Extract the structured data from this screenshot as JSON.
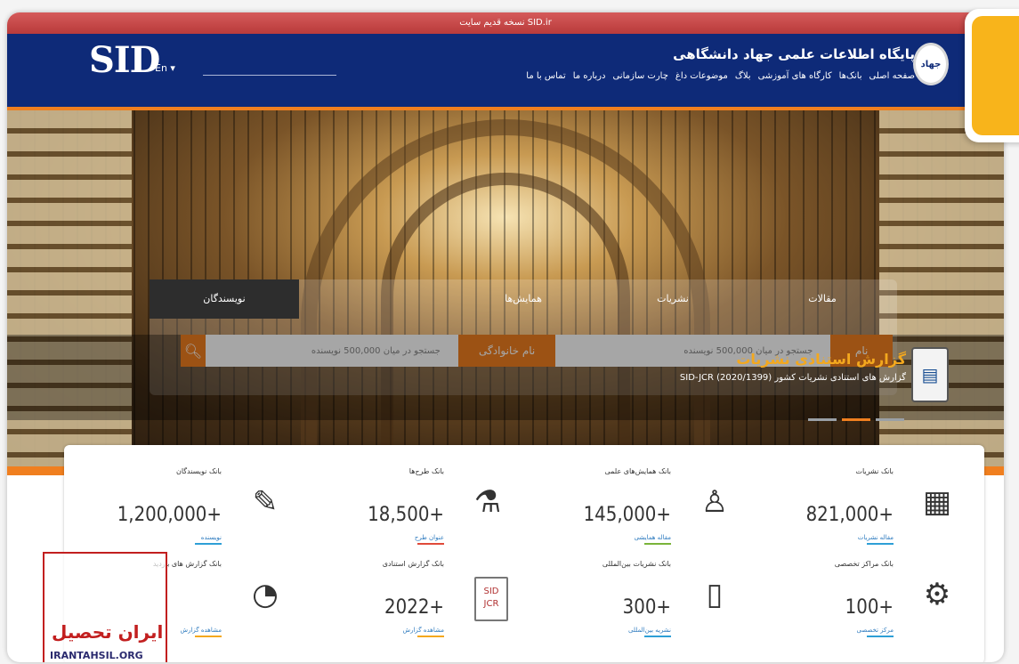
{
  "header": {
    "old_site_link": "نسخه قدیم سایت SID.ir",
    "logo": "SID",
    "language": "En",
    "site_title": "پایگاه اطلاعات علمی جهاد دانشگاهی",
    "nav_items": [
      "صفحه اصلی",
      "بانک‌ها",
      "کارگاه های آموزشی",
      "بلاگ",
      "موضوعات داغ",
      "چارت سازمانی",
      "درباره ما",
      "تماس با ما"
    ],
    "emblem_text": "جهاد"
  },
  "search": {
    "tabs": [
      "مقالات",
      "نشریات",
      "همایش‌ها",
      "",
      "نویسندگان"
    ],
    "active_tab_index": 4,
    "field1_label": "نام",
    "field1_placeholder": "جستجو در میان 500,000 نویسنده",
    "field2_label": "نام خانوادگی",
    "field2_placeholder": "جستجو در میان 500,000 نویسنده",
    "search_icon": "search-icon"
  },
  "report": {
    "title": "گزارش استنادی نشریات",
    "subtitle": "گزارش های استنادی نشریات کشور SID-JCR (2020/1399)"
  },
  "stats": [
    {
      "label": "بانک نشریات",
      "value": "821,000+",
      "link": "مقاله نشریات",
      "icon": "journal-icon",
      "accent": "#2e9fd6"
    },
    {
      "label": "بانک همایش‌های علمی",
      "value": "145,000+",
      "link": "مقاله همایشی",
      "icon": "lectern-icon",
      "accent": "#7ab43a"
    },
    {
      "label": "بانک طرح‌ها",
      "value": "18,500+",
      "link": "عنوان طرح",
      "icon": "microscope-icon",
      "accent": "#e04a3a"
    },
    {
      "label": "بانک نویسندگان",
      "value": "1,200,000+",
      "link": "نویسنده",
      "icon": "pen-icon",
      "accent": "#2e9fd6"
    },
    {
      "label": "بانک مراکز تخصصی",
      "value": "100+",
      "link": "مرکز تخصصی",
      "icon": "gear-hex-icon",
      "accent": "#2e9fd6"
    },
    {
      "label": "بانک نشریات بین‌المللی",
      "value": "300+",
      "link": "نشریه بین‌المللی",
      "icon": "mobile-doc-icon",
      "accent": "#2e9fd6"
    },
    {
      "label": "بانک گزارش استنادی",
      "value": "2022+",
      "link": "مشاهده گزارش",
      "icon": "sid-jcr-icon",
      "accent": "#f3a81e"
    },
    {
      "label": "بانک گزارش های بازدید",
      "value": "",
      "link": "مشاهده گزارش",
      "icon": "report-chart-icon",
      "accent": "#f3a81e"
    }
  ],
  "watermark": {
    "text": "ایران تحصیل",
    "url": "IRANTAHSIL.ORG"
  }
}
